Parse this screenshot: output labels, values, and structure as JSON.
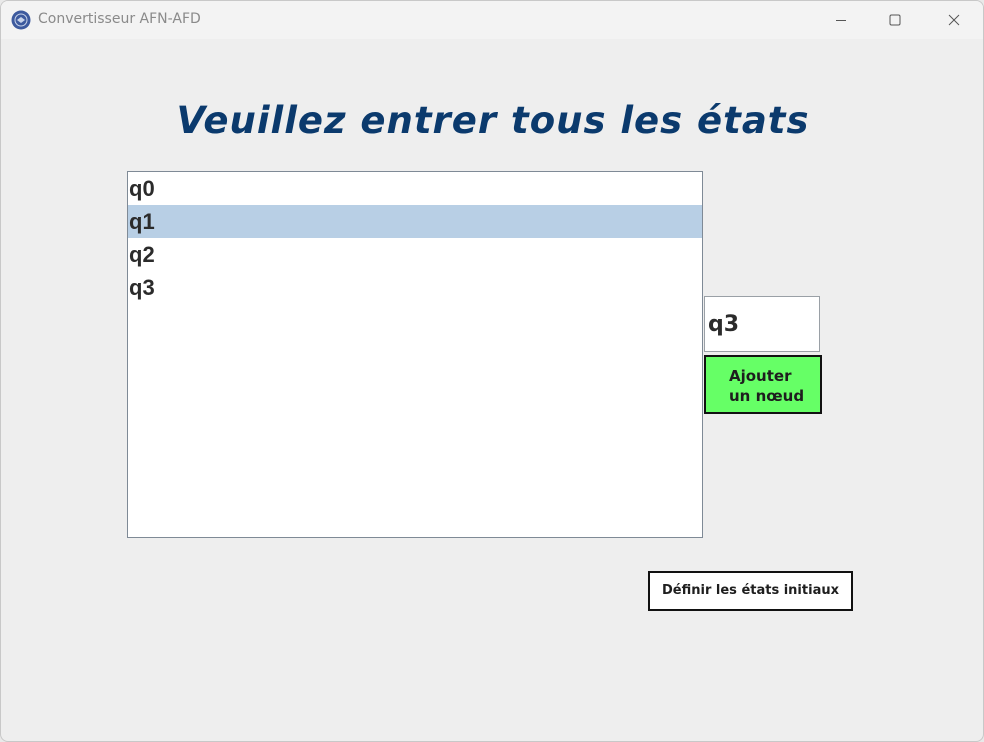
{
  "window": {
    "title": "Convertisseur AFN-AFD",
    "controls": [
      "minimize-icon",
      "maximize-icon",
      "close-icon"
    ]
  },
  "heading": "Veuillez entrer tous les états",
  "states_list": {
    "items": [
      {
        "label": "q0",
        "selected": false
      },
      {
        "label": "q1",
        "selected": true
      },
      {
        "label": "q2",
        "selected": false
      },
      {
        "label": "q3",
        "selected": false
      }
    ]
  },
  "node_input": {
    "value": "q3"
  },
  "add_button": {
    "line1": "Ajouter",
    "line2": "un nœud"
  },
  "define_initial_button": {
    "label": "Définir les états initiaux"
  },
  "colors": {
    "heading": "#0b3a6d",
    "selection": "#b8cfe5",
    "add_button_bg": "#66ff66"
  }
}
